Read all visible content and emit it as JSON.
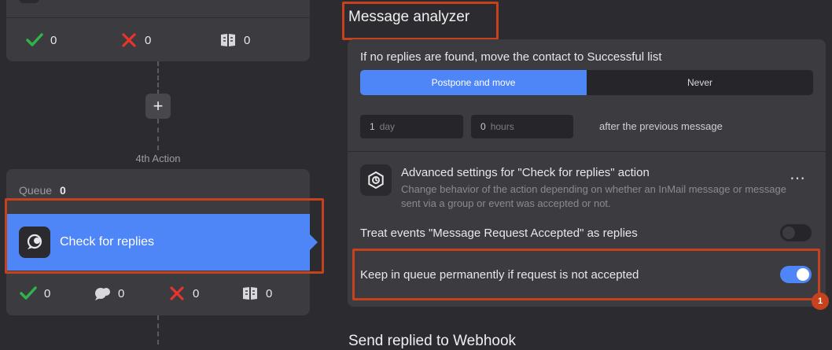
{
  "left": {
    "top_card_stats": [
      "0",
      "0",
      "0"
    ],
    "action_caption": "4th Action",
    "queue_label": "Queue",
    "queue_count": "0",
    "action_title": "Check for replies",
    "bottom_stats": [
      "0",
      "0",
      "0",
      "0"
    ],
    "colors": {
      "accent": "#4f86f7",
      "success": "#2fb34a",
      "fail": "#e8342c",
      "highlight": "#c6421c"
    }
  },
  "right": {
    "section_title": "Message analyzer",
    "no_reply_label": "If no replies are found, move the contact to Successful list",
    "segments": [
      "Postpone and move",
      "Never"
    ],
    "days_value": "1",
    "days_unit": "day",
    "hours_value": "0",
    "hours_unit": "hours",
    "after_text": "after the previous message",
    "adv_title": "Advanced settings for \"Check for replies\" action",
    "adv_desc": "Change behavior of the action depending on whether an InMail message or message sent via a group or event was accepted or not.",
    "more_icon": "⋯",
    "treat_events_label": "Treat events \"Message Request Accepted\" as replies",
    "treat_events_on": false,
    "keep_queue_label": "Keep in queue permanently if request is not accepted",
    "keep_queue_on": true,
    "badge_number": "1",
    "next_section_title": "Send replied to Webhook"
  }
}
